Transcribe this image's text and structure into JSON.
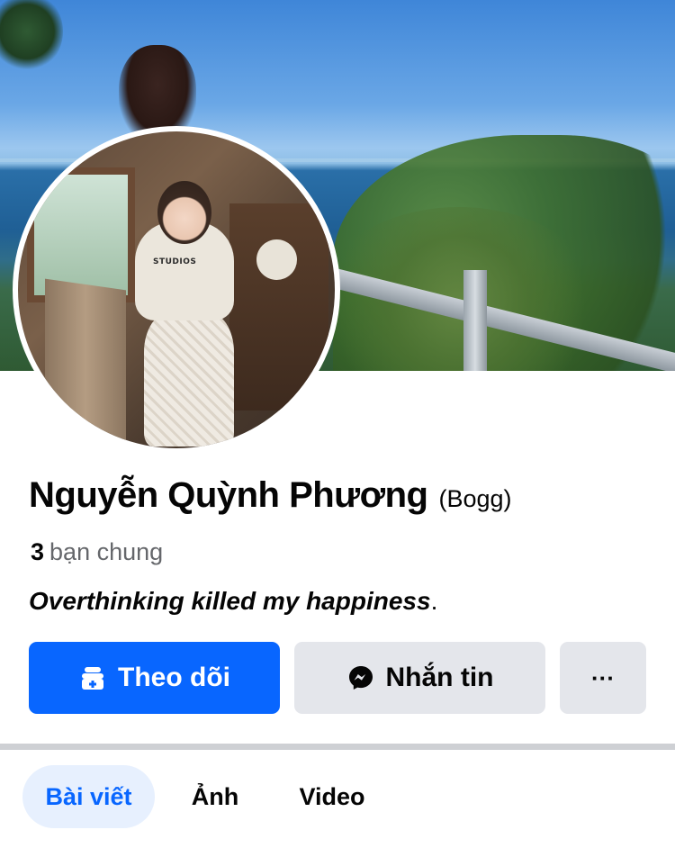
{
  "profile": {
    "name": "Nguyễn Quỳnh Phương",
    "alt_name": "(Bogg)",
    "mutual_count": "3",
    "mutual_label": "bạn chung",
    "bio": "Overthinking killed my happiness",
    "bio_end": "."
  },
  "avatar_shirt_text": "STUDIOS",
  "actions": {
    "follow_label": "Theo dõi",
    "message_label": "Nhắn tin",
    "more_label": "···"
  },
  "tabs": [
    {
      "label": "Bài viết",
      "active": true
    },
    {
      "label": "Ảnh",
      "active": false
    },
    {
      "label": "Video",
      "active": false
    }
  ],
  "colors": {
    "primary": "#0866ff",
    "secondary_button": "#e4e6eb",
    "active_tab_bg": "#e7f0fe",
    "muted_text": "#65676b"
  },
  "icons": {
    "follow": "follow-icon",
    "message": "messenger-icon"
  }
}
